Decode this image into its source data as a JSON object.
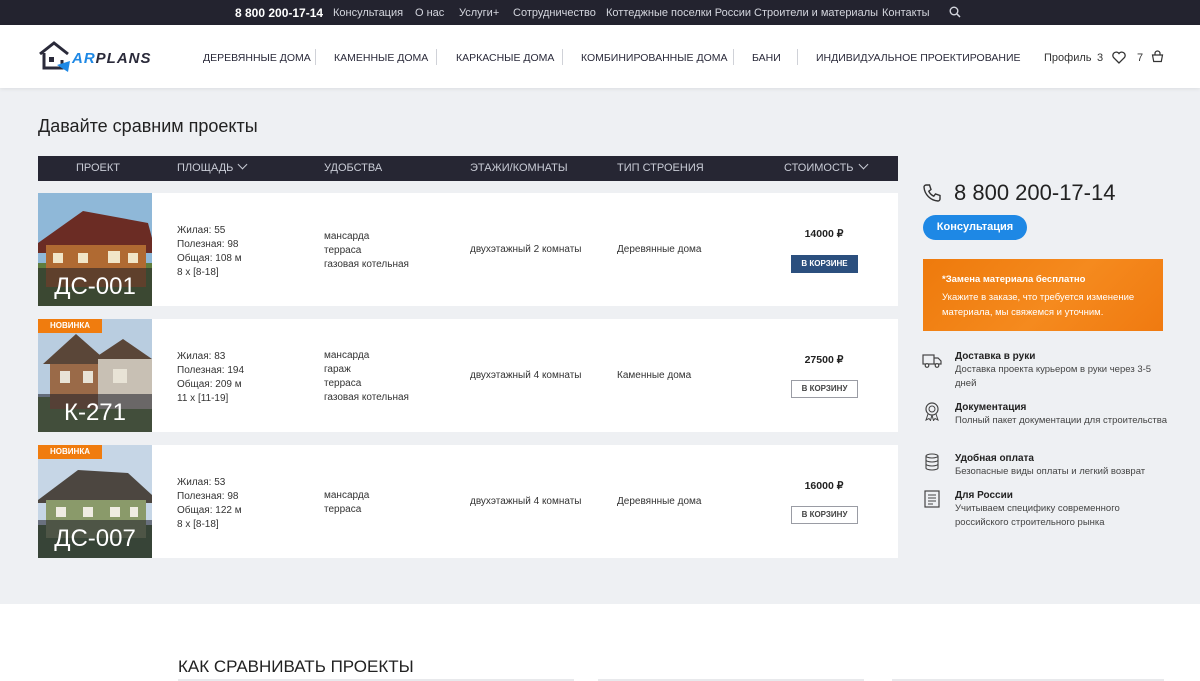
{
  "topbar": {
    "phone": "8 800 200-17-14",
    "links": [
      "Консультация",
      "О нас",
      "Услуги+",
      "Сотрудничество",
      "Коттеджные поселки России",
      "Строители и материалы",
      "Контакты"
    ]
  },
  "header": {
    "logo_prefix": "AR",
    "logo_suffix": "PLANS",
    "nav": [
      "ДЕРЕВЯННЫЕ ДОМА",
      "КАМЕННЫЕ ДОМА",
      "КАРКАСНЫЕ ДОМА",
      "КОМБИНИРОВАННЫЕ ДОМА",
      "БАНИ",
      "ИНДИВИДУАЛЬНОЕ ПРОЕКТИРОВАНИЕ"
    ],
    "profile": "Профиль",
    "favorites_count": "3",
    "cart_count": "7"
  },
  "page": {
    "title": "Давайте сравним проекты"
  },
  "table": {
    "headers": [
      "ПРОЕКТ",
      "ПЛОЩАДЬ",
      "УДОБСТВА",
      "ЭТАЖИ/КОМНАТЫ",
      "ТИП СТРОЕНИЯ",
      "СТОИМОСТЬ"
    ],
    "rows": [
      {
        "code": "ДС-001",
        "badge": "",
        "area": [
          "Жилая: 55",
          "Полезная: 98",
          "Общая: 108 м",
          "8 х [8-18]"
        ],
        "amenities": [
          "мансарда",
          "терраса",
          "газовая котельная"
        ],
        "floors": "двухэтажный 2 комнаты",
        "type": "Деревянные дома",
        "price": "14000 ₽",
        "cart": "В КОРЗИНЕ"
      },
      {
        "code": "К-271",
        "badge": "НОВИНКА",
        "area": [
          "Жилая: 83",
          "Полезная: 194",
          "Общая: 209 м",
          "11 х [11-19]"
        ],
        "amenities": [
          "мансарда",
          "гараж",
          "терраса",
          "газовая котельная"
        ],
        "floors": "двухэтажный 4 комнаты",
        "type": "Каменные дома",
        "price": "27500 ₽",
        "cart": "В КОРЗИНУ"
      },
      {
        "code": "ДС-007",
        "badge": "НОВИНКА",
        "area": [
          "Жилая: 53",
          "Полезная: 98",
          "Общая: 122 м",
          "8 х [8-18]"
        ],
        "amenities": [
          "мансарда",
          "терраса"
        ],
        "floors": "двухэтажный 4 комнаты",
        "type": "Деревянные дома",
        "price": "16000 ₽",
        "cart": "В КОРЗИНУ"
      }
    ]
  },
  "sidebar": {
    "phone": "8 800 200-17-14",
    "consult_button": "Консультация",
    "promo_title": "*Замена материала бесплатно",
    "promo_text": "Укажите в заказе, что требуется изменение материала, мы свяжемся и уточним.",
    "features": [
      {
        "icon": "truck-icon",
        "title": "Доставка в руки",
        "text": "Доставка проекта курьером в руки через 3-5 дней"
      },
      {
        "icon": "medal-icon",
        "title": "Документация",
        "text": "Полный пакет документации для строительства"
      },
      {
        "icon": "coins-icon",
        "title": "Удобная оплата",
        "text": "Безопасные виды оплаты и легкий возврат"
      },
      {
        "icon": "document-icon",
        "title": "Для России",
        "text": "Учитываем специфику современного российского строительного рынка"
      }
    ]
  },
  "bottom": {
    "title": "КАК СРАВНИВАТЬ ПРОЕКТЫ"
  },
  "colors": {
    "accent_blue": "#1e88e5",
    "promo_orange": "#f07c0e",
    "dark_bar": "#23232f",
    "in_cart_button": "#2b4f7e"
  }
}
